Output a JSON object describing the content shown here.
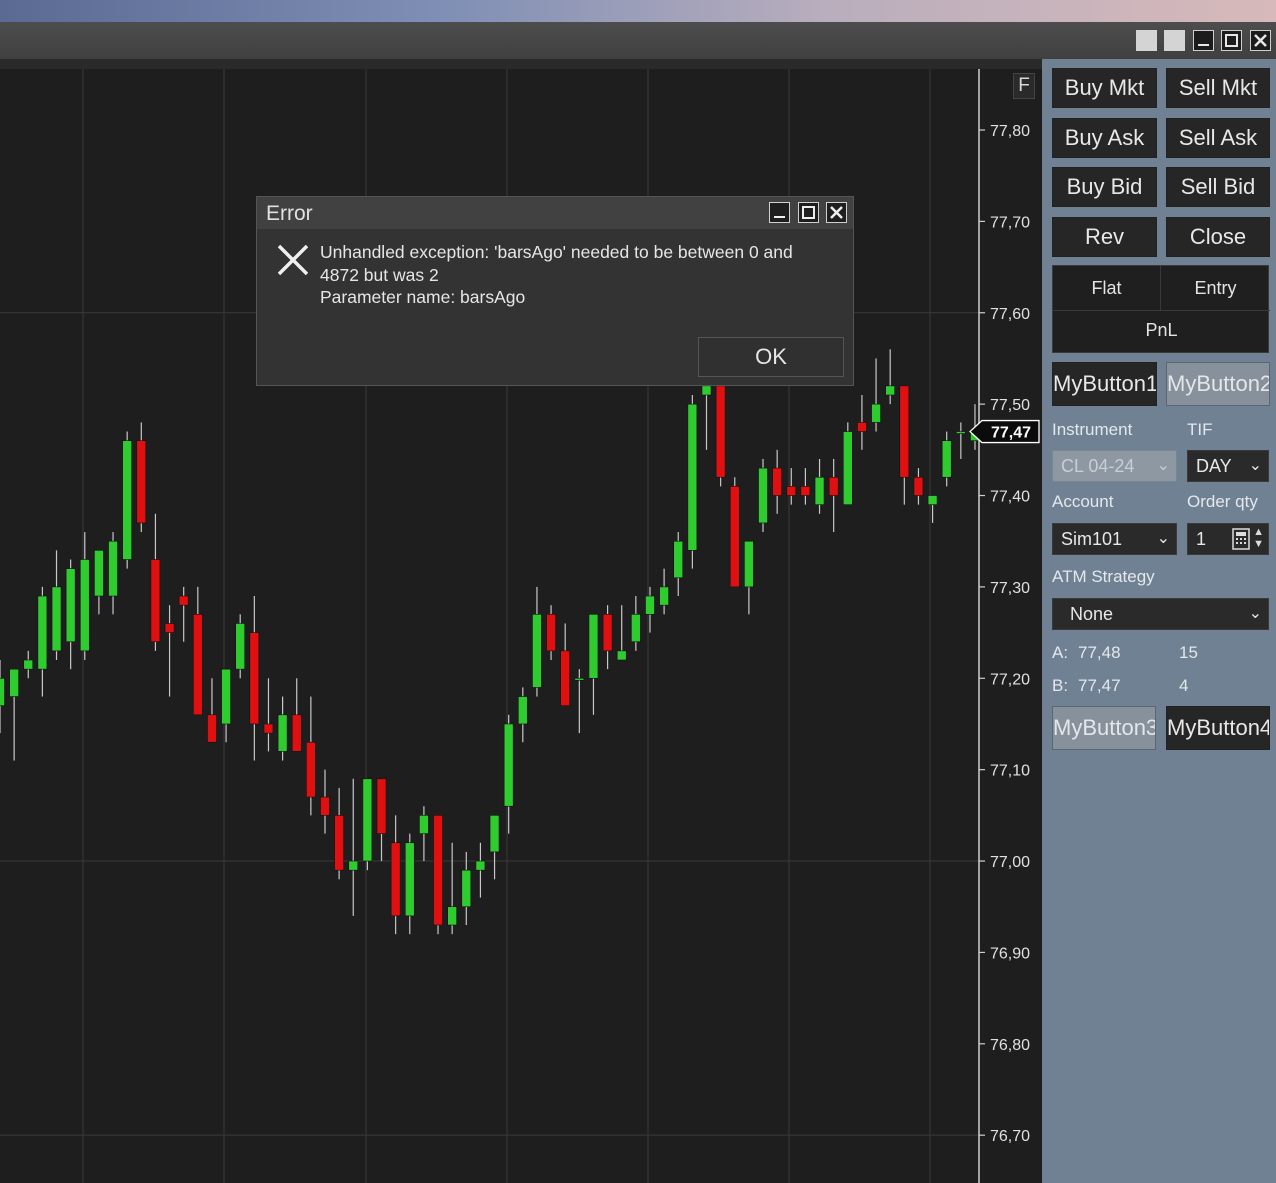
{
  "window": {
    "controls": [
      "minimize-icon",
      "maximize-icon",
      "close-icon"
    ]
  },
  "chart": {
    "f_button": "F",
    "current_price_label": "77,47",
    "price_ticks": [
      "77,80",
      "77,70",
      "77,60",
      "77,50",
      "77,40",
      "77,30",
      "77,20",
      "77,10",
      "77,00",
      "76,90",
      "76,80",
      "76,70"
    ],
    "colors": {
      "up": "#2ecc2e",
      "down": "#e01010",
      "wick": "#c8c8c8",
      "background": "#1e1e1e",
      "grid": "#3a3a3a"
    }
  },
  "chart_data": {
    "type": "candlestick",
    "ylim": [
      76.65,
      77.88
    ],
    "y_ticks": [
      77.8,
      77.7,
      77.6,
      77.5,
      77.4,
      77.3,
      77.2,
      77.1,
      77.0,
      76.9,
      76.8,
      76.7
    ],
    "current_price": 77.47,
    "candles": [
      {
        "o": 77.17,
        "h": 77.22,
        "l": 77.14,
        "c": 77.2
      },
      {
        "o": 77.18,
        "h": 77.2,
        "l": 77.11,
        "c": 77.21
      },
      {
        "o": 77.21,
        "h": 77.23,
        "l": 77.2,
        "c": 77.22
      },
      {
        "o": 77.21,
        "h": 77.3,
        "l": 77.18,
        "c": 77.29
      },
      {
        "o": 77.23,
        "h": 77.34,
        "l": 77.22,
        "c": 77.3
      },
      {
        "o": 77.24,
        "h": 77.33,
        "l": 77.21,
        "c": 77.32
      },
      {
        "o": 77.23,
        "h": 77.36,
        "l": 77.22,
        "c": 77.33
      },
      {
        "o": 77.29,
        "h": 77.34,
        "l": 77.27,
        "c": 77.34
      },
      {
        "o": 77.29,
        "h": 77.36,
        "l": 77.27,
        "c": 77.35
      },
      {
        "o": 77.33,
        "h": 77.47,
        "l": 77.32,
        "c": 77.46
      },
      {
        "o": 77.46,
        "h": 77.48,
        "l": 77.36,
        "c": 77.37
      },
      {
        "o": 77.33,
        "h": 77.38,
        "l": 77.23,
        "c": 77.24
      },
      {
        "o": 77.26,
        "h": 77.28,
        "l": 77.18,
        "c": 77.25
      },
      {
        "o": 77.29,
        "h": 77.3,
        "l": 77.24,
        "c": 77.28
      },
      {
        "o": 77.27,
        "h": 77.3,
        "l": 77.16,
        "c": 77.16
      },
      {
        "o": 77.16,
        "h": 77.2,
        "l": 77.13,
        "c": 77.13
      },
      {
        "o": 77.15,
        "h": 77.2,
        "l": 77.13,
        "c": 77.21
      },
      {
        "o": 77.21,
        "h": 77.27,
        "l": 77.2,
        "c": 77.26
      },
      {
        "o": 77.25,
        "h": 77.29,
        "l": 77.11,
        "c": 77.15
      },
      {
        "o": 77.15,
        "h": 77.2,
        "l": 77.12,
        "c": 77.14
      },
      {
        "o": 77.12,
        "h": 77.18,
        "l": 77.11,
        "c": 77.16
      },
      {
        "o": 77.16,
        "h": 77.2,
        "l": 77.12,
        "c": 77.12
      },
      {
        "o": 77.13,
        "h": 77.18,
        "l": 77.05,
        "c": 77.07
      },
      {
        "o": 77.07,
        "h": 77.1,
        "l": 77.03,
        "c": 77.05
      },
      {
        "o": 77.05,
        "h": 77.08,
        "l": 76.98,
        "c": 76.99
      },
      {
        "o": 76.99,
        "h": 77.09,
        "l": 76.94,
        "c": 77.0
      },
      {
        "o": 77.0,
        "h": 77.09,
        "l": 76.99,
        "c": 77.09
      },
      {
        "o": 77.09,
        "h": 77.09,
        "l": 77.0,
        "c": 77.03
      },
      {
        "o": 77.02,
        "h": 77.05,
        "l": 76.92,
        "c": 76.94
      },
      {
        "o": 76.94,
        "h": 77.03,
        "l": 76.92,
        "c": 77.02
      },
      {
        "o": 77.03,
        "h": 77.06,
        "l": 77.0,
        "c": 77.05
      },
      {
        "o": 77.05,
        "h": 77.05,
        "l": 76.92,
        "c": 76.93
      },
      {
        "o": 76.93,
        "h": 77.02,
        "l": 76.92,
        "c": 76.95
      },
      {
        "o": 76.95,
        "h": 77.01,
        "l": 76.93,
        "c": 76.99
      },
      {
        "o": 76.99,
        "h": 77.02,
        "l": 76.96,
        "c": 77.0
      },
      {
        "o": 77.01,
        "h": 77.05,
        "l": 76.98,
        "c": 77.05
      },
      {
        "o": 77.06,
        "h": 77.16,
        "l": 77.03,
        "c": 77.15
      },
      {
        "o": 77.15,
        "h": 77.19,
        "l": 77.13,
        "c": 77.18
      },
      {
        "o": 77.19,
        "h": 77.3,
        "l": 77.18,
        "c": 77.27
      },
      {
        "o": 77.27,
        "h": 77.28,
        "l": 77.22,
        "c": 77.23
      },
      {
        "o": 77.23,
        "h": 77.26,
        "l": 77.18,
        "c": 77.17
      },
      {
        "o": 77.2,
        "h": 77.21,
        "l": 77.14,
        "c": 77.2
      },
      {
        "o": 77.2,
        "h": 77.27,
        "l": 77.16,
        "c": 77.27
      },
      {
        "o": 77.27,
        "h": 77.28,
        "l": 77.21,
        "c": 77.23
      },
      {
        "o": 77.22,
        "h": 77.28,
        "l": 77.22,
        "c": 77.23
      },
      {
        "o": 77.24,
        "h": 77.29,
        "l": 77.23,
        "c": 77.27
      },
      {
        "o": 77.27,
        "h": 77.3,
        "l": 77.25,
        "c": 77.29
      },
      {
        "o": 77.28,
        "h": 77.32,
        "l": 77.27,
        "c": 77.3
      },
      {
        "o": 77.31,
        "h": 77.36,
        "l": 77.29,
        "c": 77.35
      },
      {
        "o": 77.34,
        "h": 77.51,
        "l": 77.32,
        "c": 77.5
      },
      {
        "o": 77.51,
        "h": 77.53,
        "l": 77.45,
        "c": 77.52
      },
      {
        "o": 77.52,
        "h": 77.53,
        "l": 77.41,
        "c": 77.42
      },
      {
        "o": 77.41,
        "h": 77.42,
        "l": 77.3,
        "c": 77.3
      },
      {
        "o": 77.3,
        "h": 77.35,
        "l": 77.27,
        "c": 77.35
      },
      {
        "o": 77.37,
        "h": 77.44,
        "l": 77.36,
        "c": 77.43
      },
      {
        "o": 77.43,
        "h": 77.45,
        "l": 77.38,
        "c": 77.4
      },
      {
        "o": 77.41,
        "h": 77.43,
        "l": 77.39,
        "c": 77.4
      },
      {
        "o": 77.41,
        "h": 77.43,
        "l": 77.39,
        "c": 77.4
      },
      {
        "o": 77.39,
        "h": 77.44,
        "l": 77.38,
        "c": 77.42
      },
      {
        "o": 77.42,
        "h": 77.44,
        "l": 77.36,
        "c": 77.4
      },
      {
        "o": 77.39,
        "h": 77.48,
        "l": 77.39,
        "c": 77.47
      },
      {
        "o": 77.48,
        "h": 77.51,
        "l": 77.45,
        "c": 77.47
      },
      {
        "o": 77.48,
        "h": 77.55,
        "l": 77.47,
        "c": 77.5
      },
      {
        "o": 77.51,
        "h": 77.56,
        "l": 77.5,
        "c": 77.52
      },
      {
        "o": 77.52,
        "h": 77.52,
        "l": 77.39,
        "c": 77.42
      },
      {
        "o": 77.42,
        "h": 77.43,
        "l": 77.39,
        "c": 77.4
      },
      {
        "o": 77.39,
        "h": 77.4,
        "l": 77.37,
        "c": 77.4
      },
      {
        "o": 77.42,
        "h": 77.47,
        "l": 77.41,
        "c": 77.46
      },
      {
        "o": 77.47,
        "h": 77.48,
        "l": 77.44,
        "c": 77.47
      },
      {
        "o": 77.46,
        "h": 77.5,
        "l": 77.45,
        "c": 77.47
      }
    ]
  },
  "panel": {
    "buttons": [
      {
        "label": "Buy Mkt"
      },
      {
        "label": "Sell Mkt"
      },
      {
        "label": "Buy Ask"
      },
      {
        "label": "Sell Ask"
      },
      {
        "label": "Buy Bid"
      },
      {
        "label": "Sell Bid"
      },
      {
        "label": "Rev"
      },
      {
        "label": "Close"
      }
    ],
    "pnl": {
      "flat": "Flat",
      "entry": "Entry",
      "pnl": "PnL"
    },
    "my_buttons": {
      "b1": "MyButton1",
      "b2": "MyButton2",
      "b3": "MyButton3",
      "b4": "MyButton4"
    },
    "instrument_label": "Instrument",
    "instrument_value": "CL 04-24",
    "tif_label": "TIF",
    "tif_value": "DAY",
    "account_label": "Account",
    "account_value": "Sim101",
    "order_qty_label": "Order qty",
    "order_qty_value": "1",
    "atm_label": "ATM Strategy",
    "atm_value": "None",
    "ask": {
      "label": "A:",
      "price": "77,48",
      "size": "15"
    },
    "bid": {
      "label": "B:",
      "price": "77,47",
      "size": "4"
    }
  },
  "dialog": {
    "title": "Error",
    "message_lines": [
      "Unhandled exception: 'barsAgo' needed to be between 0 and",
      "4872 but was 2",
      "Parameter name: barsAgo"
    ],
    "ok_label": "OK"
  }
}
